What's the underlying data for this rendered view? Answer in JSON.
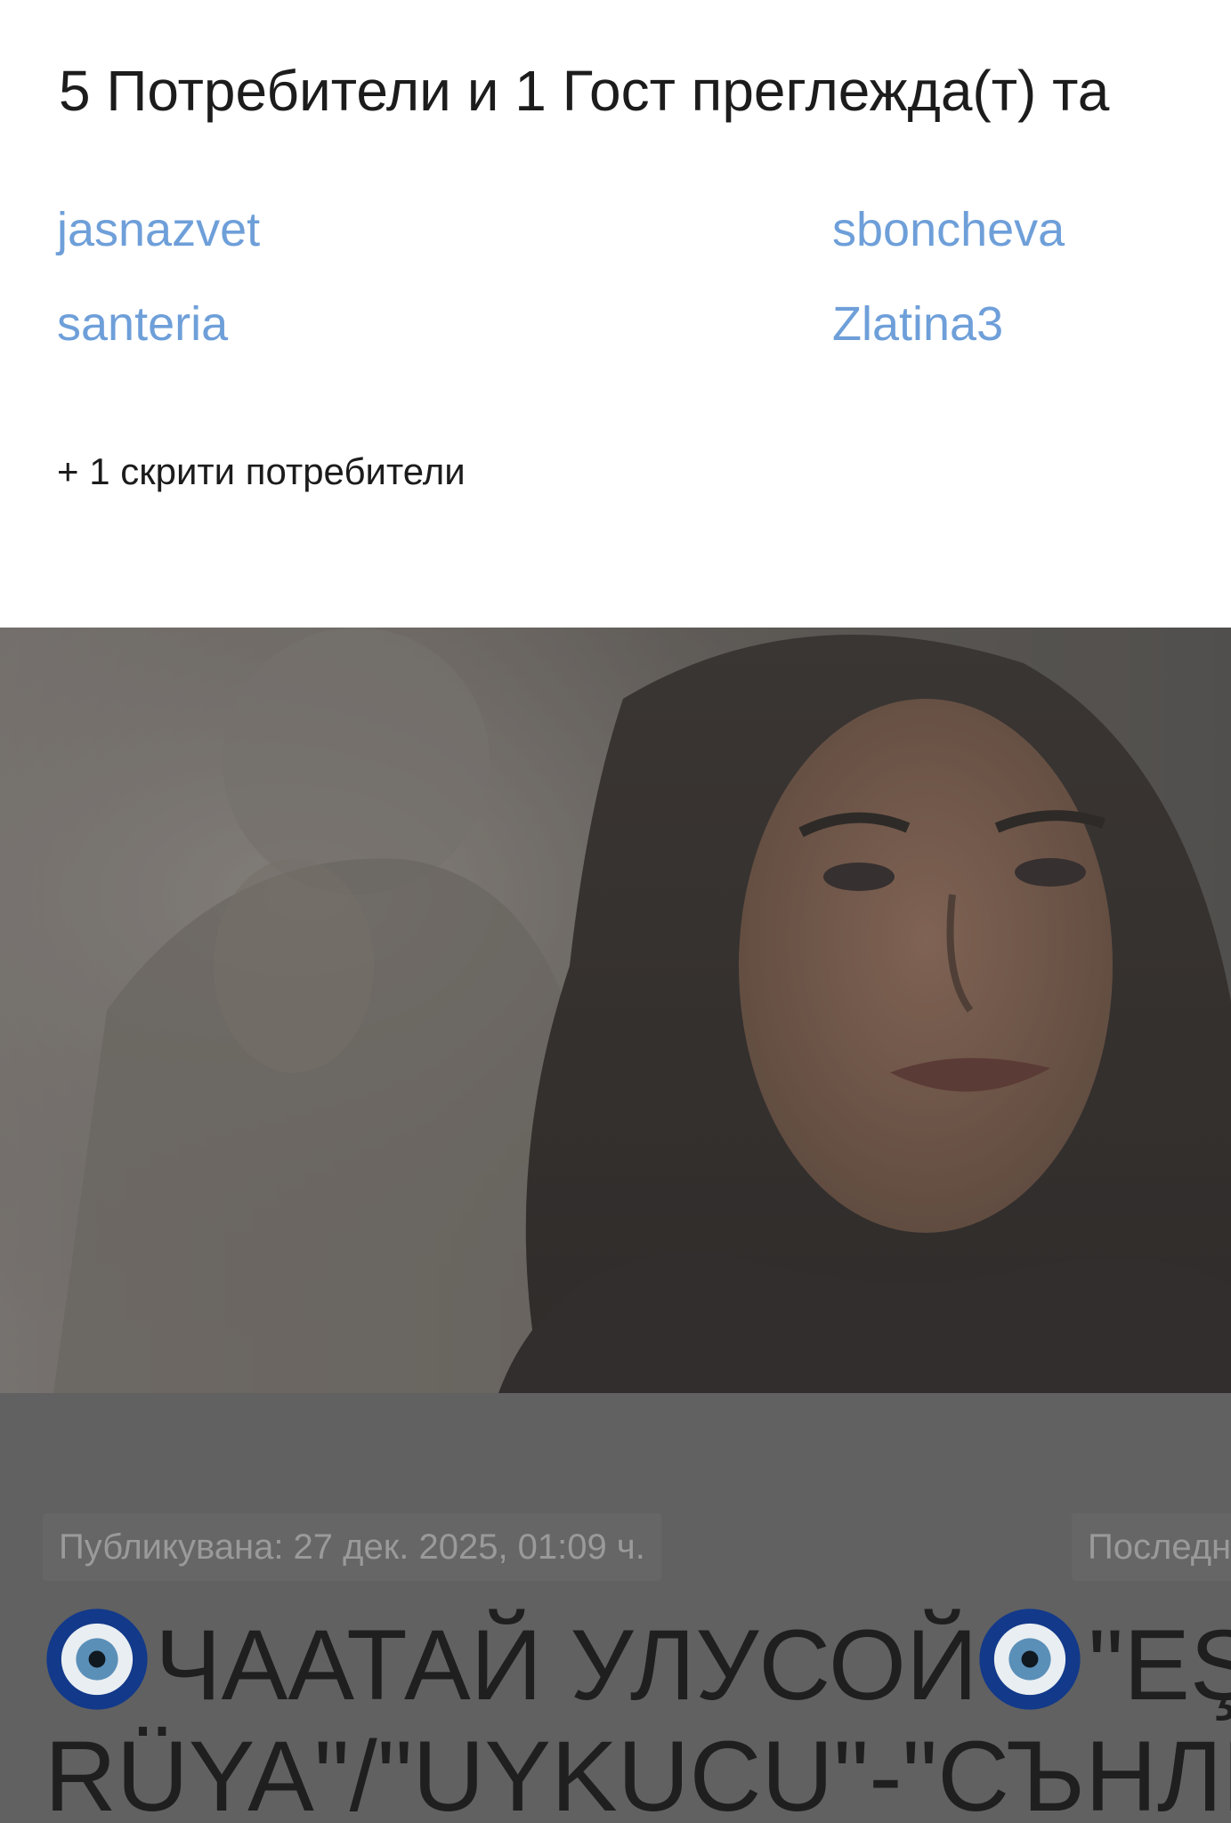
{
  "viewers": {
    "title": "5 Потребители и 1 Гост преглежда(т) та",
    "users": [
      "jasnazvet",
      "sboncheva",
      "santeria",
      "Zlatina3"
    ],
    "hidden_users_text": "+ 1 скрити потребители",
    "link_color": "#6e9fd9"
  },
  "topic": {
    "published": "Публикувана: 27 дек. 2025, 01:09 ч.",
    "last": "Последн",
    "title_part1": "ЧААТАЙ УЛУСОЙ",
    "title_part2": "\"EŞF",
    "title_line2": "RÜYA\"/\"UYKUCU\"-\"СЪНЛИВ",
    "icon": "nazar-amulet-icon"
  },
  "colors": {
    "overlay": "#616161",
    "title_text": "#1f1f1f"
  }
}
